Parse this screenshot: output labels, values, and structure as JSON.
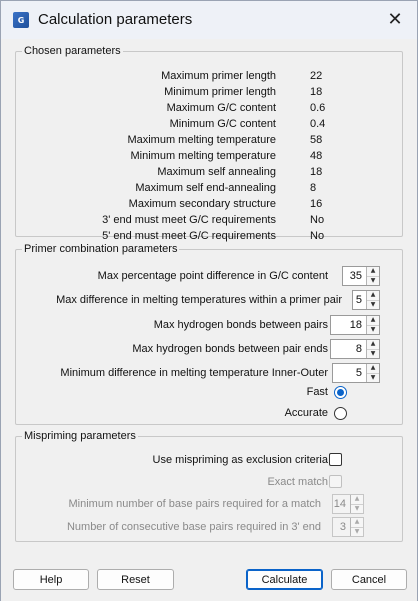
{
  "window": {
    "title": "Calculation parameters",
    "close_glyph": "✕",
    "app_icon_text": "G"
  },
  "chosen": {
    "legend": "Chosen parameters",
    "rows": [
      {
        "label": "Maximum primer length",
        "value": "22"
      },
      {
        "label": "Minimum primer length",
        "value": "18"
      },
      {
        "label": "Maximum G/C content",
        "value": "0.6"
      },
      {
        "label": "Minimum G/C content",
        "value": "0.4"
      },
      {
        "label": "Maximum melting temperature",
        "value": "58"
      },
      {
        "label": "Minimum melting temperature",
        "value": "48"
      },
      {
        "label": "Maximum self annealing",
        "value": "18"
      },
      {
        "label": "Maximum self end-annealing",
        "value": "8"
      },
      {
        "label": "Maximum secondary structure",
        "value": "16"
      },
      {
        "label": "3' end must meet G/C requirements",
        "value": "No"
      },
      {
        "label": "5' end must meet G/C requirements",
        "value": "No"
      }
    ]
  },
  "combination": {
    "legend": "Primer combination parameters",
    "fields": [
      {
        "label": "Max percentage point difference in G/C content",
        "value": "35"
      },
      {
        "label": "Max difference in melting temperatures within a primer pair",
        "value": "5"
      },
      {
        "label": "Max hydrogen bonds between pairs",
        "value": "18"
      },
      {
        "label": "Max hydrogen bonds between pair ends",
        "value": "8"
      },
      {
        "label": "Minimum difference in melting temperature Inner-Outer",
        "value": "5"
      }
    ],
    "fast_label": "Fast",
    "accurate_label": "Accurate",
    "selected_mode": "Fast"
  },
  "mispriming": {
    "legend": "Mispriming parameters",
    "use_label": "Use mispriming as exclusion criteria",
    "exact_label": "Exact match",
    "min_pairs_label": "Minimum number of base pairs required for a match",
    "min_pairs_value": "14",
    "consecutive_label": "Number of consecutive base pairs required in 3' end",
    "consecutive_value": "3"
  },
  "buttons": {
    "help": "Help",
    "reset": "Reset",
    "calculate": "Calculate",
    "cancel": "Cancel"
  },
  "colors": {
    "accent": "#0a63c9"
  }
}
